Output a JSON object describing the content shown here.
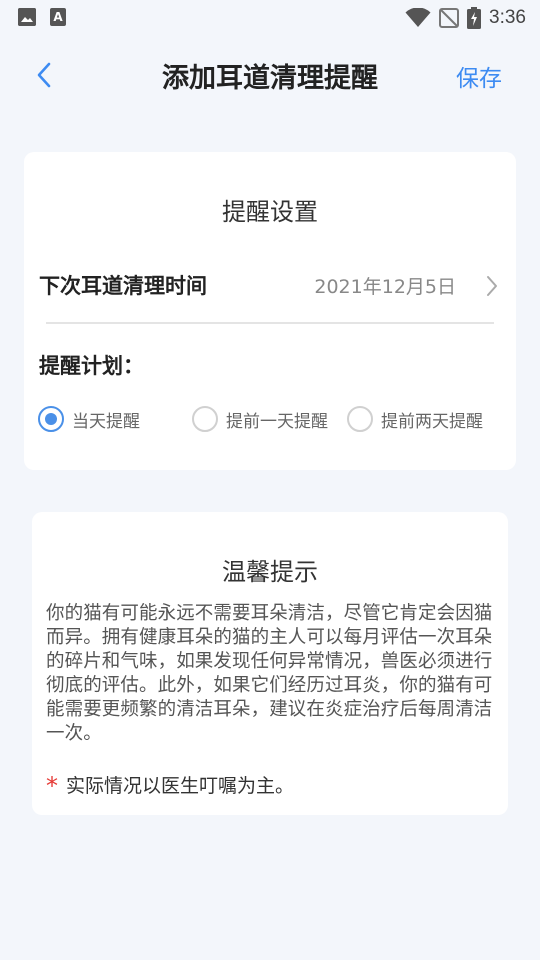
{
  "status_bar": {
    "time": "3:36",
    "icons": [
      "image-icon",
      "text-a-icon",
      "wifi-icon",
      "no-signal-icon",
      "battery-charging-icon"
    ]
  },
  "header": {
    "title": "添加耳道清理提醒",
    "save_label": "保存",
    "back_icon": "chevron-left-icon"
  },
  "reminder_settings": {
    "title": "提醒设置",
    "next_time_label": "下次耳道清理时间",
    "next_time_value": "2021年12月5日",
    "plan_label": "提醒计划：",
    "options": [
      {
        "label": "当天提醒",
        "checked": true
      },
      {
        "label": "提前一天提醒",
        "checked": false
      },
      {
        "label": "提前两天提醒",
        "checked": false
      }
    ]
  },
  "tips": {
    "title": "温馨提示",
    "body": "你的猫有可能永远不需要耳朵清洁，尽管它肯定会因猫而异。拥有健康耳朵的猫的主人可以每月评估一次耳朵的碎片和气味，如果发现任何异常情况，兽医必须进行彻底的评估。此外，如果它们经历过耳炎，你的猫有可能需要更频繁的清洁耳朵，建议在炎症治疗后每周清洁一次。",
    "note_marker": "*",
    "note": "实际情况以医生叮嘱为主。"
  },
  "colors": {
    "accent": "#3d8bf2",
    "radio_checked": "#4a90e8",
    "background": "#f3f6fb",
    "asterisk": "#e53935"
  }
}
